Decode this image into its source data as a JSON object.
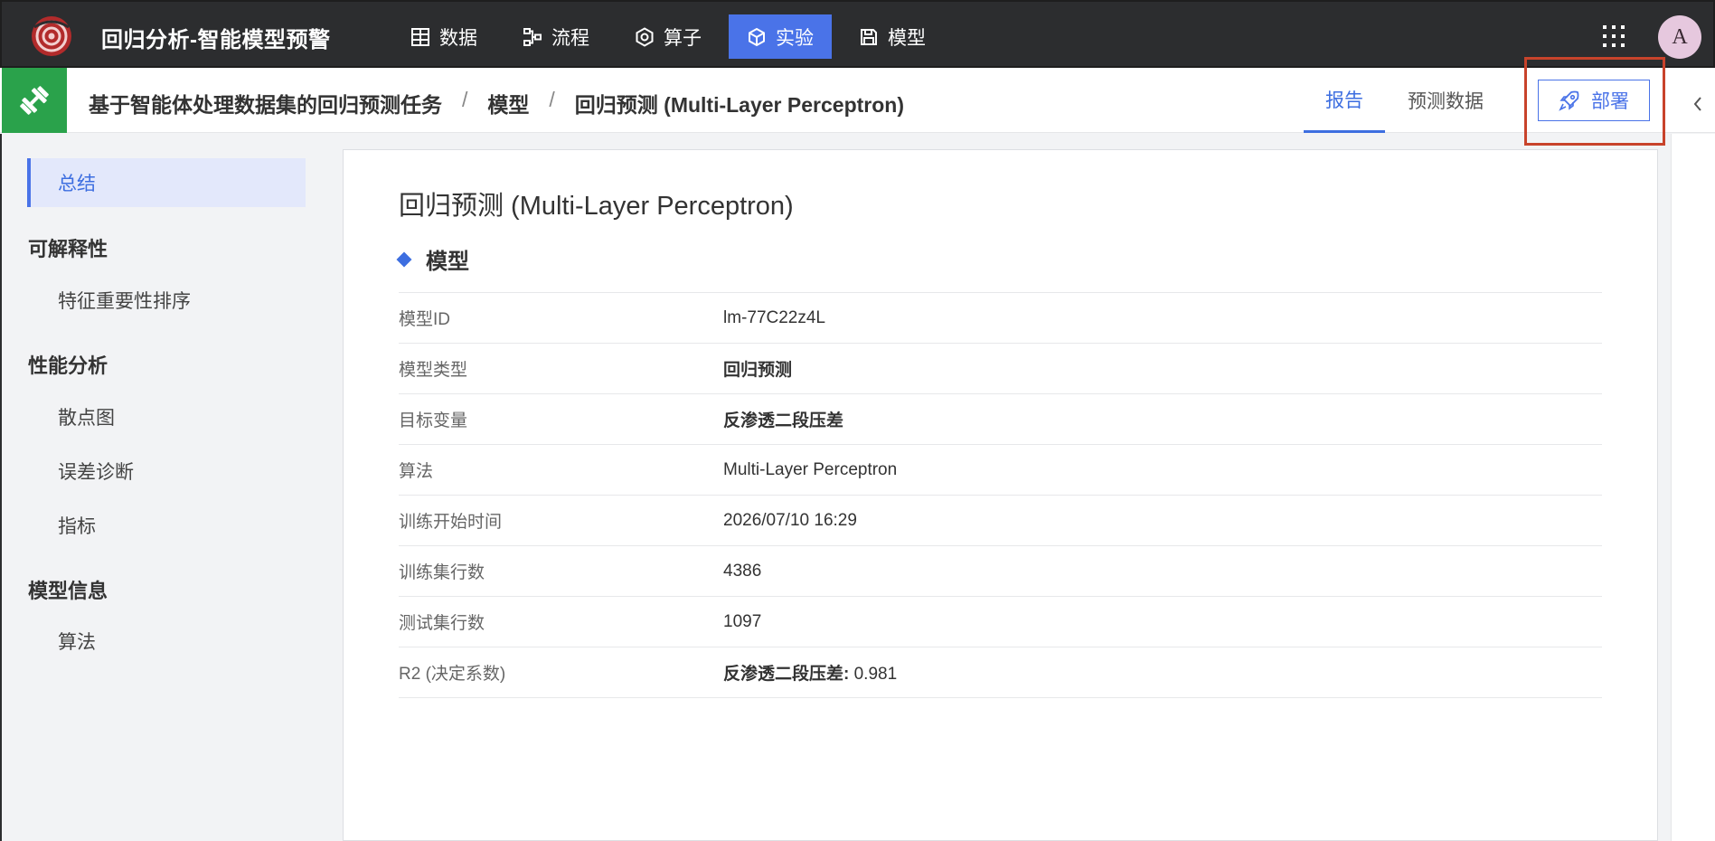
{
  "app": {
    "title": "回归分析-智能模型预警",
    "avatar_letter": "A"
  },
  "nav": [
    {
      "label": "数据",
      "icon": "table-icon",
      "active": false
    },
    {
      "label": "流程",
      "icon": "flow-icon",
      "active": false
    },
    {
      "label": "算子",
      "icon": "operator-icon",
      "active": false
    },
    {
      "label": "实验",
      "icon": "cube-icon",
      "active": true
    },
    {
      "label": "模型",
      "icon": "save-icon",
      "active": false
    }
  ],
  "breadcrumb": {
    "project": "基于智能体处理数据集的回归预测任务",
    "sep": "/",
    "section": "模型",
    "current": "回归预测 (Multi-Layer Perceptron)"
  },
  "tabs": {
    "report": "报告",
    "predict": "预测数据"
  },
  "deploy_label": "部署",
  "sidebar": {
    "summary": "总结",
    "group_explain": "可解释性",
    "feature_importance": "特征重要性排序",
    "group_perf": "性能分析",
    "scatter": "散点图",
    "error_diag": "误差诊断",
    "metrics": "指标",
    "group_model": "模型信息",
    "algorithm": "算法"
  },
  "main": {
    "title": "回归预测 (Multi-Layer Perceptron)",
    "section": "模型",
    "rows": [
      {
        "key": "模型ID",
        "value": "lm-77C22z4L"
      },
      {
        "key": "模型类型",
        "value": "回归预测"
      },
      {
        "key": "目标变量",
        "value": "反渗透二段压差"
      },
      {
        "key": "算法",
        "value": "Multi-Layer Perceptron"
      },
      {
        "key": "训练开始时间",
        "value": "2026/07/10 16:29"
      },
      {
        "key": "训练集行数",
        "value": "4386"
      },
      {
        "key": "测试集行数",
        "value": "1097"
      },
      {
        "key": "R2 (决定系数)",
        "value_label": "反渗透二段压差:",
        "value_num": "0.981"
      }
    ]
  },
  "colors": {
    "accent": "#4a73e8",
    "topbar": "#2c2d2f",
    "project_icon_bg": "#2aa24b",
    "highlight": "#c8432b"
  }
}
